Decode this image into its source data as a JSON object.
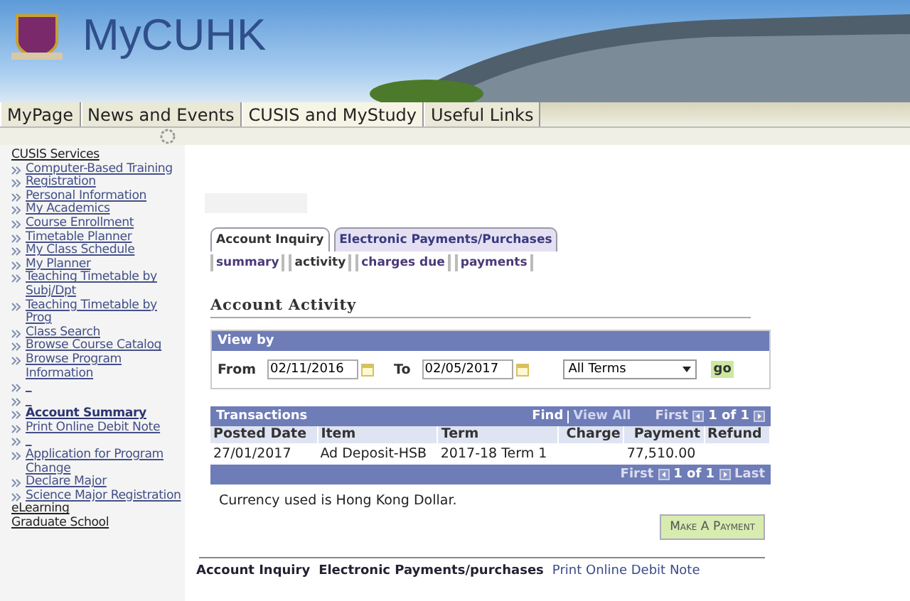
{
  "header": {
    "logo_text": "MyCUHK"
  },
  "nav_tabs": [
    {
      "label": "MyPage",
      "selected": false
    },
    {
      "label": "News and Events",
      "selected": false
    },
    {
      "label": "CUSIS and MyStudy",
      "selected": true
    },
    {
      "label": "Useful Links",
      "selected": false
    }
  ],
  "sidebar": {
    "sections": [
      {
        "label": "CUSIS Services",
        "children": [
          {
            "label": "Computer-Based Training",
            "selected": false
          },
          {
            "label": "Registration",
            "selected": false
          },
          {
            "label": "Personal Information",
            "selected": false
          },
          {
            "label": "My Academics",
            "selected": false
          },
          {
            "label": "Course Enrollment",
            "selected": false
          },
          {
            "label": "Timetable Planner",
            "selected": false
          },
          {
            "label": "My Class Schedule",
            "selected": false
          },
          {
            "label": "My Planner",
            "selected": false
          },
          {
            "label": "Teaching Timetable by Subj/Dpt",
            "selected": false
          },
          {
            "label": "Teaching Timetable by Prog",
            "selected": false
          },
          {
            "label": "Class Search",
            "selected": false
          },
          {
            "label": "Browse Course Catalog",
            "selected": false
          },
          {
            "label": "Browse Program Information",
            "selected": false
          },
          {
            "label": "_",
            "selected": false
          },
          {
            "label": "_",
            "selected": false
          },
          {
            "label": "Account Summary",
            "selected": true
          },
          {
            "label": "Print Online Debit Note",
            "selected": false
          },
          {
            "label": "_",
            "selected": false
          },
          {
            "label": "Application for Program Change",
            "selected": false
          },
          {
            "label": "Declare Major",
            "selected": false
          },
          {
            "label": "Science Major Registration",
            "selected": false
          }
        ]
      },
      {
        "label": "eLearning"
      },
      {
        "label": "Graduate School"
      }
    ]
  },
  "page_tabs": [
    {
      "label": "Account Inquiry",
      "selected": true
    },
    {
      "label": "Electronic Payments/Purchases",
      "selected": false
    }
  ],
  "sub_tabs": [
    {
      "label": "summary",
      "selected": false
    },
    {
      "label": "activity",
      "selected": true
    },
    {
      "label": "charges due",
      "selected": false
    },
    {
      "label": "payments",
      "selected": false
    }
  ],
  "title": "Account Activity",
  "view_by": {
    "header": "View by",
    "from_label": "From",
    "from_value": "02/11/2016",
    "to_label": "To",
    "to_value": "02/05/2017",
    "term": "All Terms",
    "go": "go"
  },
  "transactions": {
    "title": "Transactions",
    "find": "Find",
    "view_all": "View All",
    "first": "First",
    "count": "1 of 1",
    "columns": [
      "Posted Date",
      "Item",
      "Term",
      "Charge",
      "Payment",
      "Refund"
    ],
    "rows": [
      [
        "27/01/2017",
        "Ad Deposit-HSB",
        "2017-18 Term 1",
        "",
        "77,510.00",
        ""
      ]
    ],
    "footer": {
      "first": "First",
      "count": "1 of 1",
      "last": "Last"
    }
  },
  "currency_note": "Currency used is Hong Kong Dollar.",
  "payment_button": "Make A Payment",
  "footer_links": [
    "Account Inquiry",
    "Electronic Payments/purchases",
    "Print Online Debit Note"
  ]
}
